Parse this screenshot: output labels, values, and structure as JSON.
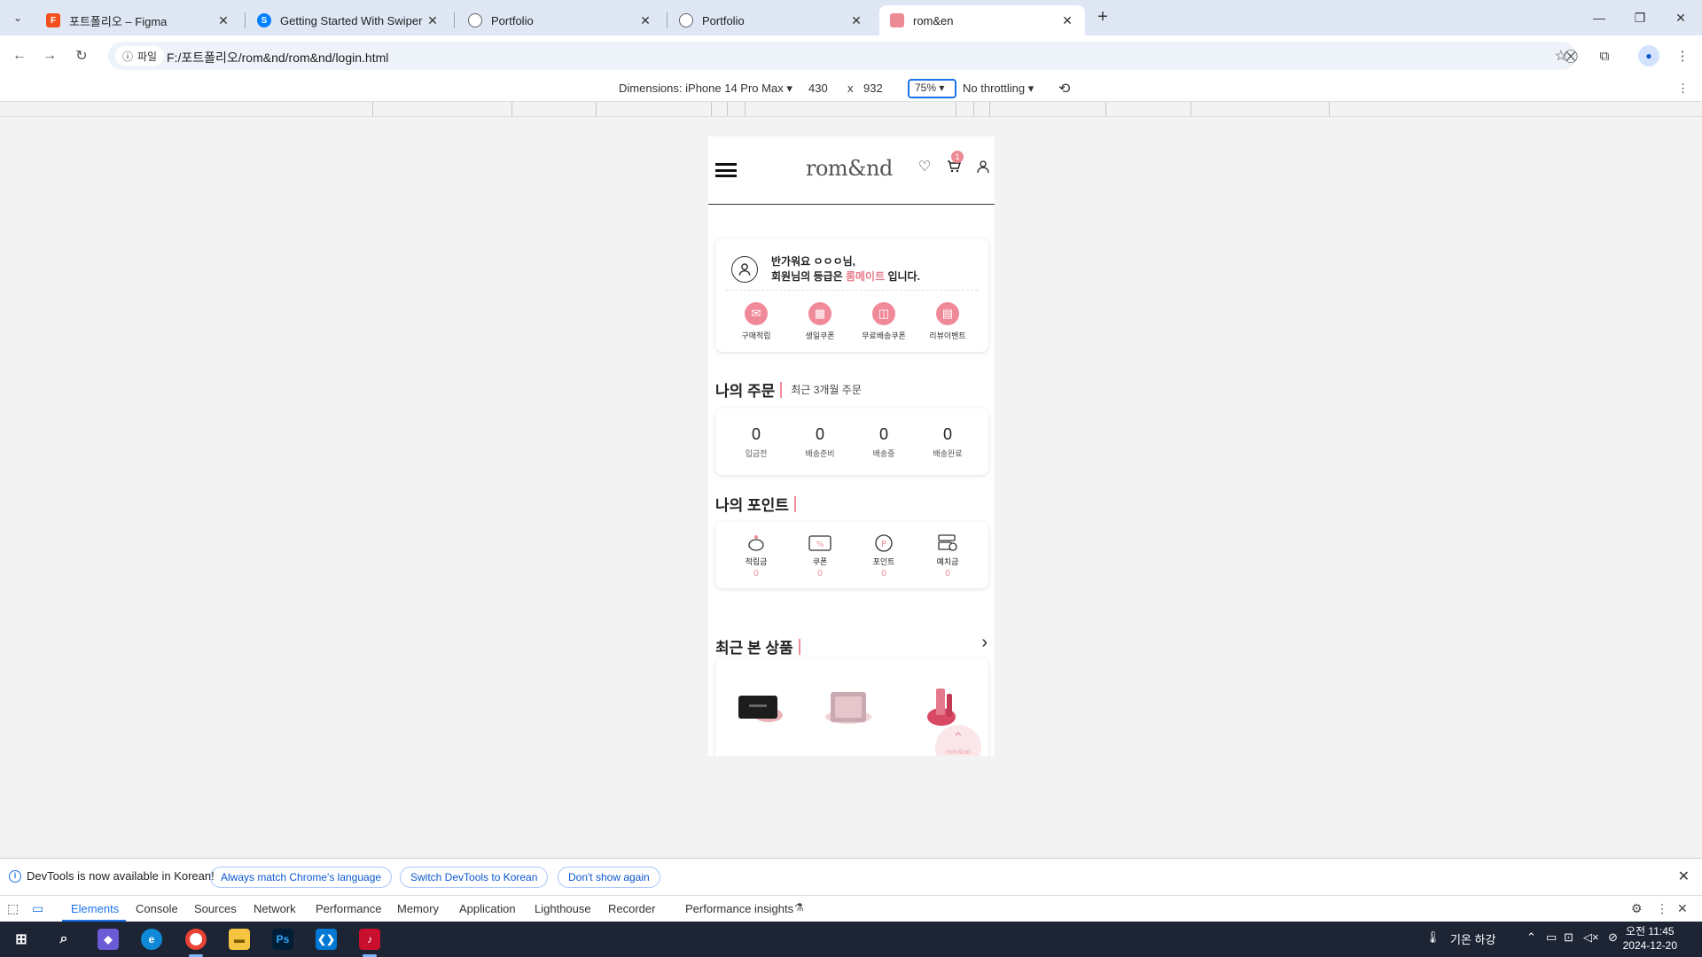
{
  "browser": {
    "tabs": [
      {
        "title": "포트폴리오 – Figma",
        "favicon": "figma-icon",
        "color": "#f24e1e"
      },
      {
        "title": "Getting Started With Swiper",
        "favicon": "swiper-icon",
        "color": "#0080ff"
      },
      {
        "title": "Portfolio",
        "favicon": "globe-icon",
        "color": "#5f6368"
      },
      {
        "title": "Portfolio",
        "favicon": "globe-icon",
        "color": "#5f6368"
      },
      {
        "title": "rom&en",
        "favicon": "romand-icon",
        "color": "#ec8a96"
      }
    ],
    "address": {
      "chip_label": "파일",
      "url": "F:/포트폴리오/rom&nd/rom&nd/login.html"
    }
  },
  "device_toolbar": {
    "dimensions_label": "Dimensions: iPhone 14 Pro Max ▾",
    "width": "430",
    "times": "x",
    "height": "932",
    "zoom": "75% ▾",
    "throttling": "No throttling ▾"
  },
  "site": {
    "logo": "rom&nd",
    "cart_count": "1",
    "welcome": {
      "line1": "반가워요 ㅇㅇㅇ님,",
      "line2_prefix": "회원님의 등급은 ",
      "grade": "롬메이트",
      "line2_suffix": " 입니다."
    },
    "benefits": [
      {
        "label": "구매적립",
        "icon": "envelope-icon"
      },
      {
        "label": "생일쿠폰",
        "icon": "gift-icon"
      },
      {
        "label": "무료배송쿠폰",
        "icon": "delivery-icon"
      },
      {
        "label": "리뷰이벤트",
        "icon": "review-icon"
      }
    ],
    "orders": {
      "title": "나의 주문",
      "subtitle": "최근 3개월 주문",
      "stats": [
        {
          "value": "0",
          "label": "입금전"
        },
        {
          "value": "0",
          "label": "배송준비"
        },
        {
          "value": "0",
          "label": "배송중"
        },
        {
          "value": "0",
          "label": "배송완료"
        }
      ]
    },
    "points": {
      "title": "나의 포인트",
      "items": [
        {
          "label": "적립금",
          "value": "0",
          "icon": "piggy-bank-icon"
        },
        {
          "label": "쿠폰",
          "value": "0",
          "icon": "coupon-icon"
        },
        {
          "label": "포인트",
          "value": "0",
          "icon": "point-icon"
        },
        {
          "label": "예치금",
          "value": "0",
          "icon": "deposit-icon"
        }
      ]
    },
    "recent": {
      "title": "최근 본 상품"
    },
    "top_button_label": "rom&nd",
    "accent_color": "#ec8a96"
  },
  "devtools": {
    "info_message": "DevTools is now available in Korean!",
    "buttons": [
      "Always match Chrome's language",
      "Switch DevTools to Korean",
      "Don't show again"
    ],
    "tabs": [
      "Elements",
      "Console",
      "Sources",
      "Network",
      "Performance",
      "Memory",
      "Application",
      "Lighthouse",
      "Recorder",
      "Performance insights"
    ]
  },
  "taskbar": {
    "weather": "기온 하강",
    "time": "오전 11:45",
    "date": "2024-12-20"
  }
}
